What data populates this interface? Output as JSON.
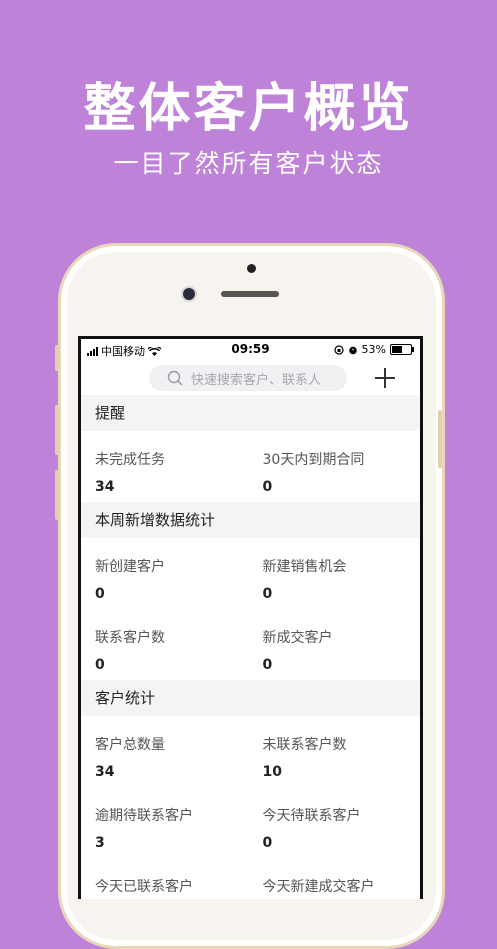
{
  "hero": {
    "title": "整体客户概览",
    "subtitle": "一目了然所有客户状态"
  },
  "status_bar": {
    "carrier": "中国移动",
    "time": "09:59",
    "battery": "53%",
    "battery_level": 0.53
  },
  "search": {
    "placeholder": "快速搜索客户、联系人"
  },
  "sections": {
    "reminder": {
      "title": "提醒",
      "items": [
        {
          "label": "未完成任务",
          "value": "34"
        },
        {
          "label": "30天内到期合同",
          "value": "0"
        }
      ]
    },
    "weekly": {
      "title": "本周新增数据统计",
      "items": [
        {
          "label": "新创建客户",
          "value": "0"
        },
        {
          "label": "新建销售机会",
          "value": "0"
        },
        {
          "label": "联系客户数",
          "value": "0"
        },
        {
          "label": "新成交客户",
          "value": "0"
        }
      ]
    },
    "customers": {
      "title": "客户统计",
      "items": [
        {
          "label": "客户总数量",
          "value": "34"
        },
        {
          "label": "未联系客户数",
          "value": "10"
        },
        {
          "label": "逾期待联系客户",
          "value": "3"
        },
        {
          "label": "今天待联系客户",
          "value": "0"
        },
        {
          "label": "今天已联系客户",
          "value": ""
        },
        {
          "label": "今天新建成交客户",
          "value": ""
        }
      ]
    }
  }
}
